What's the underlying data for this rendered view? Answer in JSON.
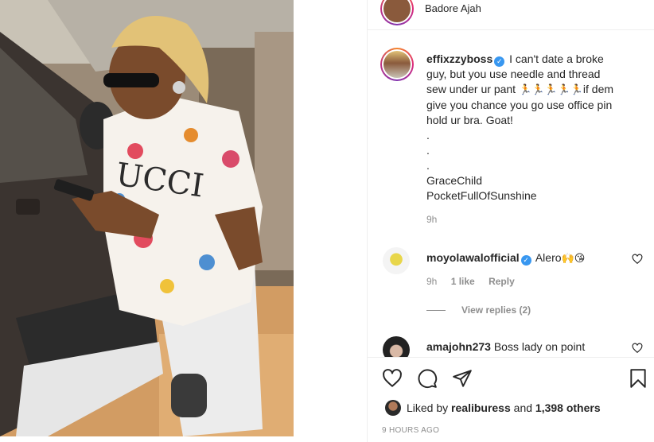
{
  "post": {
    "location": "Badore Ajah",
    "author": "effixzzyboss",
    "caption_lines": [
      "I can't date a broke",
      "guy, but you use needle and thread",
      "sew under ur pant",
      "if dem",
      "give you chance you go use office pin",
      "hold ur bra. Goat!",
      ".",
      ".",
      ".",
      "GraceChild",
      "PocketFullOfSunshine"
    ],
    "caption_emoji_run": "🏃🏃🏃🏃🏃",
    "caption_time": "9h"
  },
  "comments": [
    {
      "username": "moyolawalofficial",
      "verified": true,
      "text": "Alero",
      "emoji": "🙌😘",
      "time": "9h",
      "likes": "1 like",
      "reply_label": "Reply"
    },
    {
      "username": "amajohn273",
      "verified": false,
      "text": "Boss lady on point"
    }
  ],
  "view_replies_label": "View replies (2)",
  "actions": {
    "like_icon": "heart-icon",
    "comment_icon": "comment-icon",
    "share_icon": "share-icon",
    "save_icon": "bookmark-icon"
  },
  "likes": {
    "prefix": "Liked by",
    "user": "realiburess",
    "and": "and",
    "others": "1,398 others"
  },
  "post_time": "9 HOURS AGO",
  "colors": {
    "verified": "#3897f0",
    "text": "#262626",
    "muted": "#8e8e8e",
    "border": "#efefef"
  }
}
